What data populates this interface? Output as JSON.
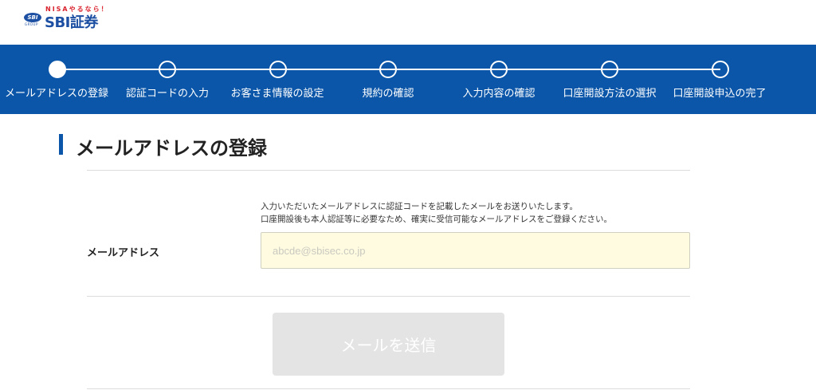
{
  "header": {
    "logo_tagline": "NISAやるなら！",
    "logo_badge": "SBI",
    "logo_group": "GROUP",
    "logo_brand": "SBI証券"
  },
  "steps": [
    {
      "label": "メールアドレスの登録",
      "active": true
    },
    {
      "label": "認証コードの入力",
      "active": false
    },
    {
      "label": "お客さま情報の設定",
      "active": false
    },
    {
      "label": "規約の確認",
      "active": false
    },
    {
      "label": "入力内容の確認",
      "active": false
    },
    {
      "label": "口座開設方法の選択",
      "active": false
    },
    {
      "label": "口座開設申込の完了",
      "active": false
    }
  ],
  "main": {
    "title": "メールアドレスの登録",
    "description_line1": "入力いただいたメールアドレスに認証コードを記載したメールをお送りいたします。",
    "description_line2": "口座開設後も本人認証等に必要なため、確実に受信可能なメールアドレスをご登録ください。",
    "email_label": "メールアドレス",
    "email_value": "",
    "email_placeholder": "abcde@sbisec.co.jp",
    "send_button_label": "メールを送信"
  },
  "colors": {
    "brand_blue": "#0b56a8",
    "logo_red": "#d9232e",
    "input_bg": "#fffbe0",
    "button_disabled": "#e4e4e4"
  }
}
